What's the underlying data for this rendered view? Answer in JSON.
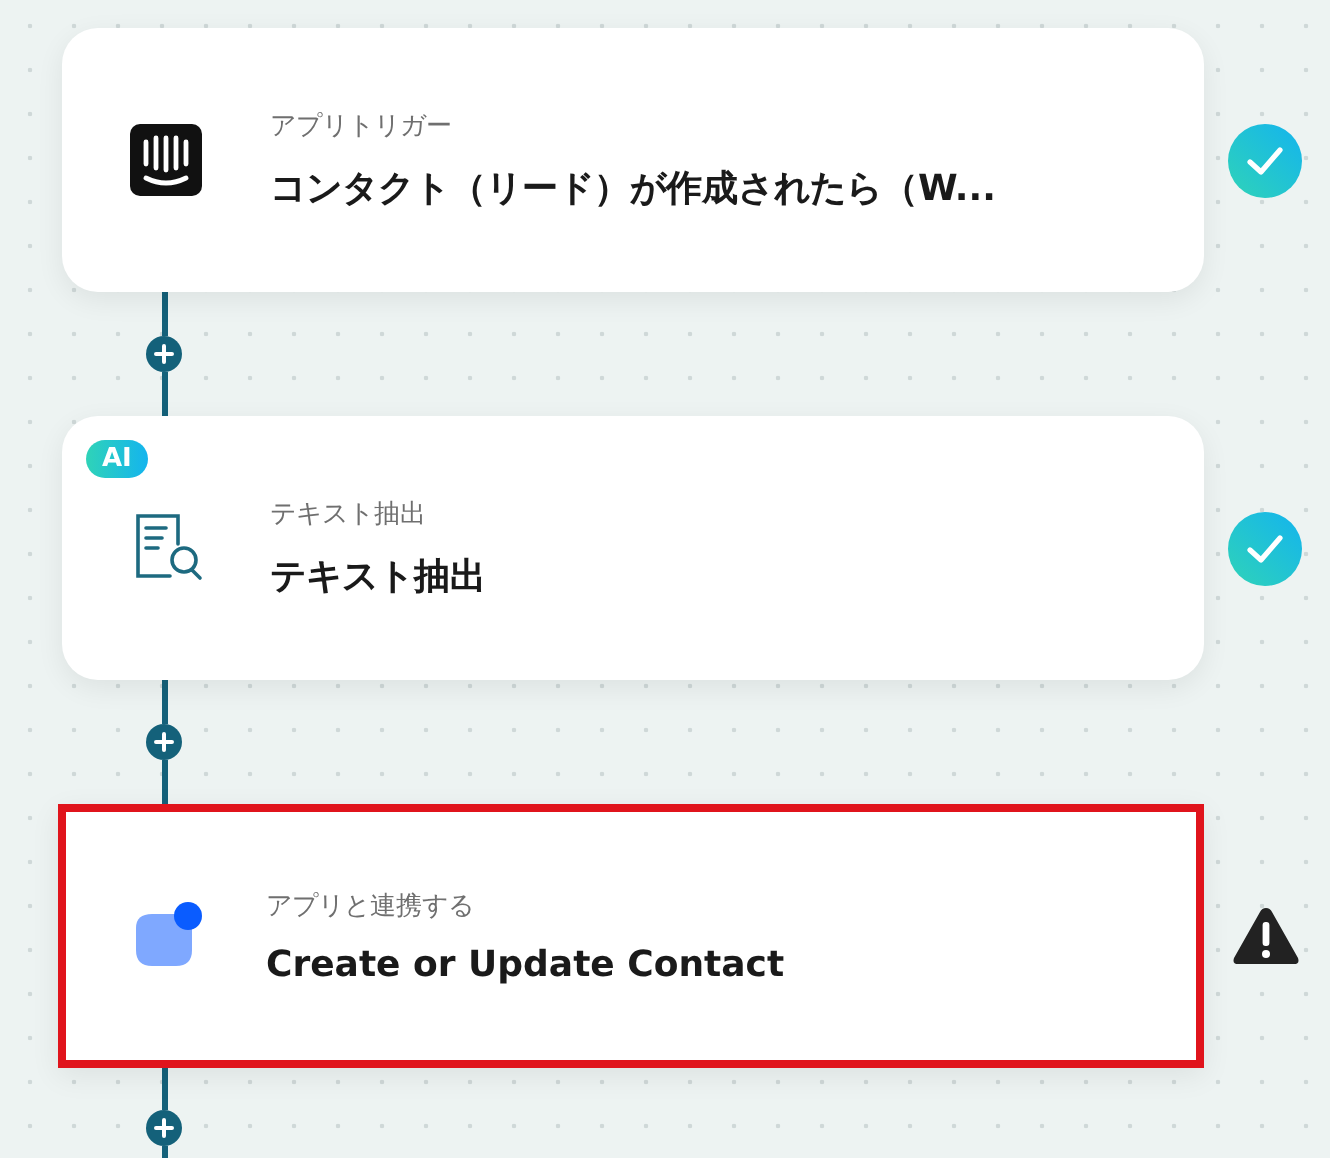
{
  "steps": [
    {
      "kind": "trigger",
      "subtitle": "アプリトリガー",
      "title": "コンタクト（リード）が作成されたら（W...",
      "error": false,
      "selected": false
    },
    {
      "kind": "ai",
      "badge": "AI",
      "subtitle": "テキスト抽出",
      "title": "テキスト抽出",
      "error": false,
      "selected": false
    },
    {
      "kind": "action",
      "subtitle": "アプリと連携する",
      "title": "Create or Update Contact",
      "error": true,
      "selected": true
    }
  ]
}
